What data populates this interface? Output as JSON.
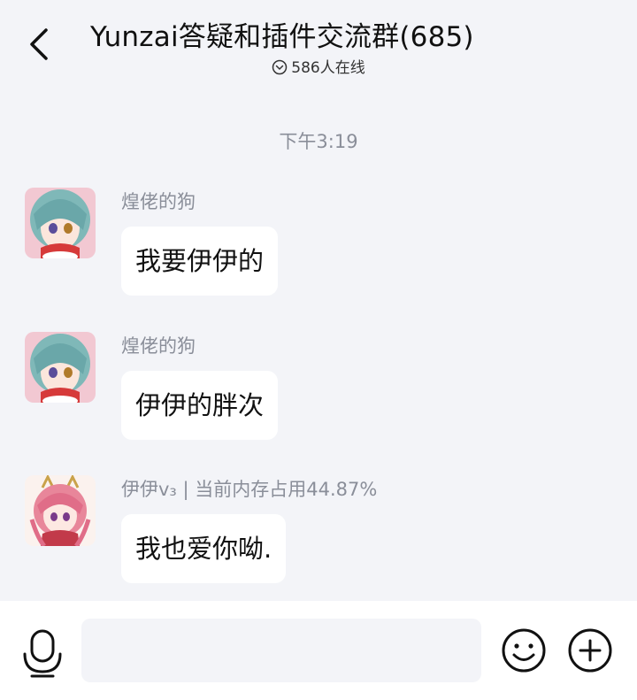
{
  "header": {
    "title": "Yunzai答疑和插件交流群(685)",
    "online": "586人在线"
  },
  "chat": {
    "timestamp": "下午3:19",
    "messages": [
      {
        "sender": "煌佬的狗",
        "text": "我要伊伊的"
      },
      {
        "sender": "煌佬的狗",
        "text": "伊伊的胖次"
      },
      {
        "sender": "伊伊v₃ | 当前内存占用44.87%",
        "text": "我也爱你呦."
      }
    ]
  },
  "input": {
    "placeholder": ""
  },
  "icons": {
    "back": "chevron-left-icon",
    "online": "chevron-down-circle-icon",
    "mic": "microphone-icon",
    "emoji": "smiley-icon",
    "plus": "plus-circle-icon"
  },
  "colors": {
    "background": "#f3f4f8",
    "bubble": "#ffffff",
    "meta_text": "#8a8e99"
  }
}
